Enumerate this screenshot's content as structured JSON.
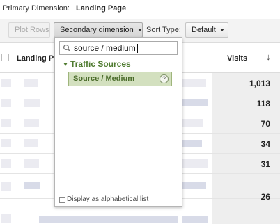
{
  "primary": {
    "label": "Primary Dimension:",
    "value": "Landing Page"
  },
  "toolbar": {
    "plot_rows": "Plot Rows",
    "secondary_dimension": "Secondary dimension",
    "sort_type_label": "Sort Type:",
    "sort_type_value": "Default"
  },
  "table": {
    "landing_page_header": "Landing Pa",
    "visits_header": "Visits",
    "sort_arrow": "↓",
    "visits": [
      "1,013",
      "118",
      "70",
      "34",
      "31",
      "26"
    ]
  },
  "dropdown": {
    "search_value": "source / medium",
    "group": "Traffic Sources",
    "item": "Source / Medium",
    "help": "?",
    "alphabetical_label": "Display as alphabetical list"
  },
  "colors": {
    "group_green": "#4f7b30",
    "selected_bg": "#d3e0bf"
  }
}
